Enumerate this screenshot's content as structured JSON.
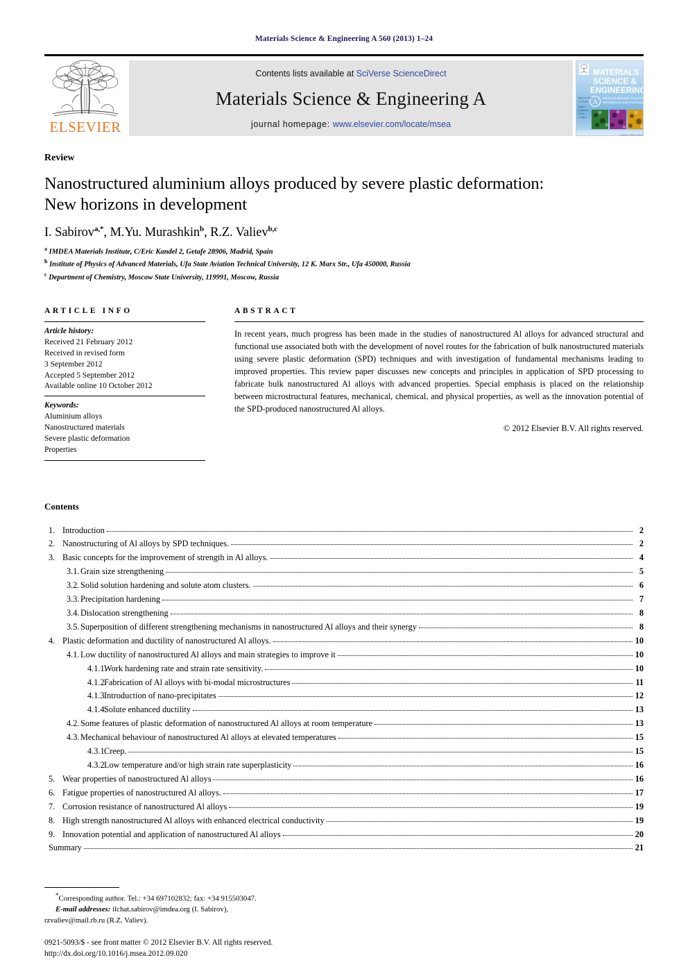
{
  "running_head": "Materials Science & Engineering A 560 (2013) 1–24",
  "masthead": {
    "publisher_logo_name": "ELSEVIER",
    "contents_prefix": "Contents lists available at ",
    "contents_link": "SciVerse ScienceDirect",
    "journal_title": "Materials Science & Engineering A",
    "homepage_prefix": "journal homepage: ",
    "homepage_link": "www.elsevier.com/locate/msea",
    "cover": {
      "line1": "MATERIALS",
      "line2": "SCIENCE &",
      "line3": "ENGINEERING",
      "badge": "A",
      "subtitle": "Structural Materials: Properties, Microstructure and Processing"
    }
  },
  "article": {
    "doctype": "Review",
    "title_line1": "Nanostructured aluminium alloys produced by severe plastic deformation:",
    "title_line2": "New horizons in development",
    "authors": [
      {
        "name": "I. Sabirov",
        "marks": "a,*"
      },
      {
        "name": "M.Yu. Murashkin",
        "marks": "b"
      },
      {
        "name": "R.Z. Valiev",
        "marks": "b,c"
      }
    ],
    "affiliations": [
      {
        "mark": "a",
        "text": "IMDEA Materials Institute, C/Eric Kandel 2, Getafe 28906, Madrid, Spain"
      },
      {
        "mark": "b",
        "text": "Institute of Physics of Advanced Materials, Ufa State Aviation Technical University, 12 K. Marx Str., Ufa 450000, Russia"
      },
      {
        "mark": "c",
        "text": "Department of Chemistry, Moscow State University, 119991, Moscow, Russia"
      }
    ]
  },
  "info": {
    "heading": "ARTICLE INFO",
    "history_label": "Article history:",
    "history": [
      "Received 21 February 2012",
      "Received in revised form",
      "3 September 2012",
      "Accepted 5 September 2012",
      "Available online 10 October 2012"
    ],
    "keywords_label": "Keywords:",
    "keywords": [
      "Aluminium alloys",
      "Nanostructured materials",
      "Severe plastic deformation",
      "Properties"
    ]
  },
  "abstract": {
    "heading": "ABSTRACT",
    "text": "In recent years, much progress has been made in the studies of nanostructured Al alloys for advanced structural and functional use associated both with the development of novel routes for the fabrication of bulk nanostructured materials using severe plastic deformation (SPD) techniques and with investigation of fundamental mechanisms leading to improved properties. This review paper discusses new concepts and principles in application of SPD processing to fabricate bulk nanostructured Al alloys with advanced properties. Special emphasis is placed on the relationship between microstructural features, mechanical, chemical, and physical properties, as well as the innovation potential of the SPD-produced nanostructured Al alloys.",
    "copyright": "© 2012 Elsevier B.V. All rights reserved."
  },
  "contents": {
    "heading": "Contents",
    "entries": [
      {
        "level": 1,
        "num": "1.",
        "label": "Introduction",
        "page": "2"
      },
      {
        "level": 1,
        "num": "2.",
        "label": "Nanostructuring of Al alloys by SPD techniques.",
        "page": "2"
      },
      {
        "level": 1,
        "num": "3.",
        "label": "Basic concepts for the improvement of strength in Al alloys.",
        "page": "4"
      },
      {
        "level": 2,
        "num": "3.1.",
        "label": "Grain size strengthening",
        "page": "5"
      },
      {
        "level": 2,
        "num": "3.2.",
        "label": "Solid solution hardening and solute atom clusters.",
        "page": "6"
      },
      {
        "level": 2,
        "num": "3.3.",
        "label": "Precipitation hardening",
        "page": "7"
      },
      {
        "level": 2,
        "num": "3.4.",
        "label": "Dislocation strengthening",
        "page": "8"
      },
      {
        "level": 2,
        "num": "3.5.",
        "label": "Superposition of different strengthening mechanisms in nanostructured Al alloys and their synergy",
        "page": "8"
      },
      {
        "level": 1,
        "num": "4.",
        "label": "Plastic deformation and ductility of nanostructured Al alloys.",
        "page": "10"
      },
      {
        "level": 2,
        "num": "4.1.",
        "label": "Low ductility of nanostructured Al alloys and main strategies to improve it",
        "page": "10"
      },
      {
        "level": 3,
        "num": "4.1.1.",
        "label": "Work hardening rate and strain rate sensitivity.",
        "page": "10"
      },
      {
        "level": 3,
        "num": "4.1.2.",
        "label": "Fabrication of Al alloys with bi-modal microstructures",
        "page": "11"
      },
      {
        "level": 3,
        "num": "4.1.3.",
        "label": "Introduction of nano-precipitates",
        "page": "12"
      },
      {
        "level": 3,
        "num": "4.1.4.",
        "label": "Solute enhanced ductility",
        "page": "13"
      },
      {
        "level": 2,
        "num": "4.2.",
        "label": "Some features of plastic deformation of nanostructured Al alloys at room temperature",
        "page": "13"
      },
      {
        "level": 2,
        "num": "4.3.",
        "label": "Mechanical behaviour of nanostructured Al alloys at elevated temperatures",
        "page": "15"
      },
      {
        "level": 3,
        "num": "4.3.1.",
        "label": "Creep.",
        "page": "15"
      },
      {
        "level": 3,
        "num": "4.3.2.",
        "label": "Low temperature and/or high strain rate superplasticity",
        "page": "16"
      },
      {
        "level": 1,
        "num": "5.",
        "label": "Wear properties of nanostructured Al alloys",
        "page": "16"
      },
      {
        "level": 1,
        "num": "6.",
        "label": "Fatigue properties of nanostructured Al alloys.",
        "page": "17"
      },
      {
        "level": 1,
        "num": "7.",
        "label": "Corrosion resistance of nanostructured Al alloys",
        "page": "19"
      },
      {
        "level": 1,
        "num": "8.",
        "label": "High strength nanostructured Al alloys with enhanced electrical conductivity",
        "page": "19"
      },
      {
        "level": 1,
        "num": "9.",
        "label": "Innovation potential and application of nanostructured Al alloys",
        "page": "20"
      },
      {
        "level": 1,
        "num": "",
        "label": "Summary",
        "page": "21"
      }
    ]
  },
  "footnotes": {
    "corresponding": "Corresponding author. Tel.: +34 697102832; fax: +34 915503047.",
    "email_label": "E-mail addresses:",
    "email_line1": " ilchat.sabirov@imdea.org (I. Sabirov),",
    "email_line2": "rzvaliev@mail.rb.ru (R.Z. Valiev)."
  },
  "imprint": {
    "line1": "0921-5093/$ - see front matter © 2012 Elsevier B.V. All rights reserved.",
    "line2": "http://dx.doi.org/10.1016/j.msea.2012.09.020"
  },
  "colors": {
    "runhead": "#1a1a5e",
    "link": "#2b4a9b",
    "elsevier_orange": "#E87722",
    "band_bg": "#e3e3e3"
  }
}
